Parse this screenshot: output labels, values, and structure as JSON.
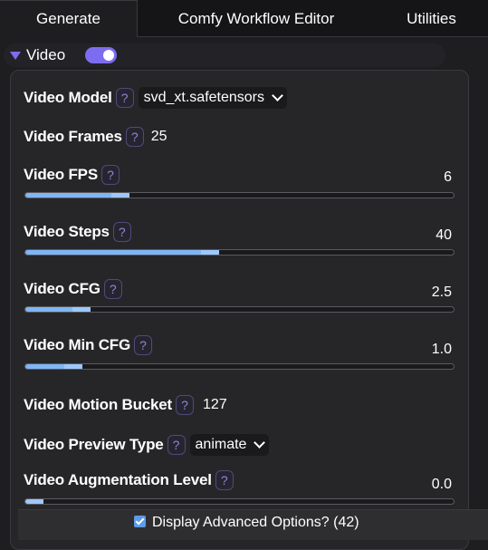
{
  "tabs": [
    "Generate",
    "Comfy Workflow Editor",
    "Utilities"
  ],
  "group": {
    "title": "Video",
    "enabled": true
  },
  "params": {
    "model": {
      "label": "Video Model",
      "help": "?",
      "value": "svd_xt.safetensors"
    },
    "frames": {
      "label": "Video Frames",
      "help": "?",
      "value": "25"
    },
    "fps": {
      "label": "Video FPS",
      "help": "?",
      "value": "6",
      "fill": 0.2
    },
    "steps": {
      "label": "Video Steps",
      "help": "?",
      "value": "40",
      "fill": 0.41
    },
    "cfg": {
      "label": "Video CFG",
      "help": "?",
      "value": "2.5",
      "fill": 0.11
    },
    "mincfg": {
      "label": "Video Min CFG",
      "help": "?",
      "value": "1.0",
      "fill": 0.09
    },
    "motion": {
      "label": "Video Motion Bucket",
      "help": "?",
      "value": "127"
    },
    "preview": {
      "label": "Video Preview Type",
      "help": "?",
      "value": "animate"
    },
    "augment": {
      "label": "Video Augmentation Level",
      "help": "?",
      "value": "0.0",
      "fill": 0.0
    }
  },
  "footer": {
    "checkbox_label": "Display Advanced Options? (42)",
    "checked": true
  },
  "colors": {
    "accent": "#7d6cf0",
    "slider_fill": "#7fb6f5"
  }
}
